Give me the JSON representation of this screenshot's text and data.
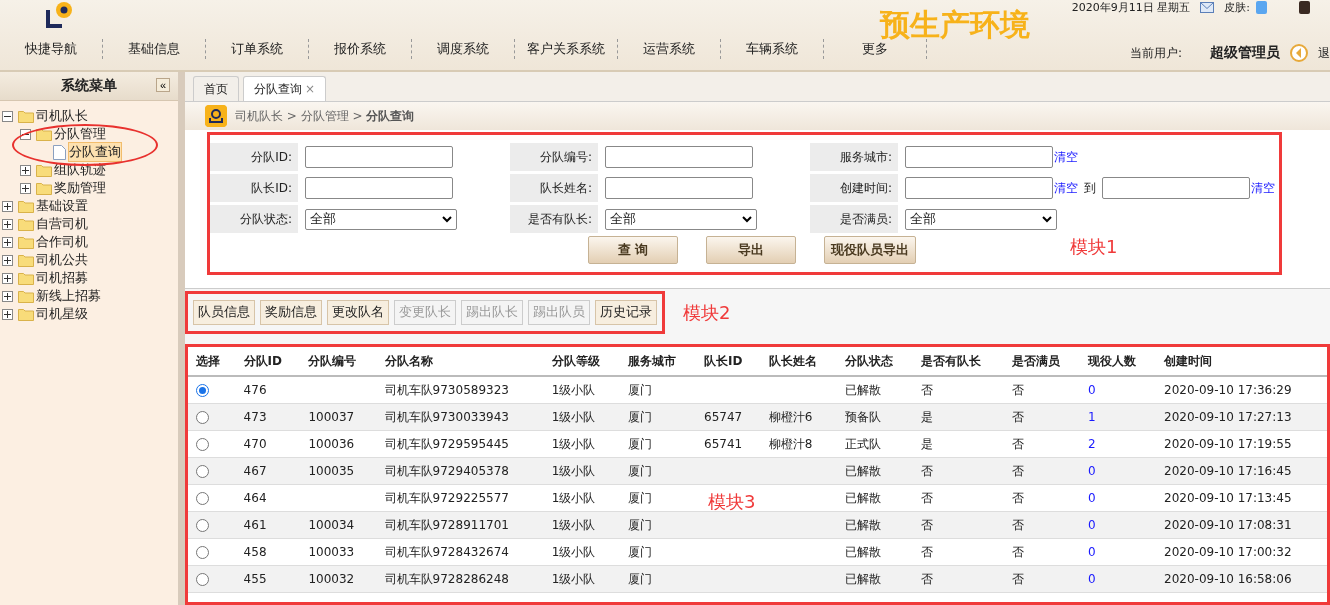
{
  "header": {
    "date": "2020年9月11日 星期五",
    "skin_label": "皮肤:",
    "env_banner": "预生产环境",
    "current_user_label": "当前用户:",
    "current_user": "超级管理员",
    "logout": "退"
  },
  "nav": [
    "快捷导航",
    "基础信息",
    "订单系统",
    "报价系统",
    "调度系统",
    "客户关系系统",
    "运营系统",
    "车辆系统",
    "更多"
  ],
  "sidebar": {
    "title": "系统菜单",
    "collapse": "«",
    "circled": true,
    "items": [
      {
        "label": "司机队长",
        "expanded": true,
        "selected": false,
        "children": [
          {
            "label": "分队管理",
            "expanded": true,
            "selected": false,
            "children": [
              {
                "label": "分队查询",
                "selected": true
              }
            ]
          },
          {
            "label": "组队轨迹",
            "expanded": false,
            "selected": false
          },
          {
            "label": "奖励管理",
            "expanded": false,
            "selected": false
          }
        ]
      },
      {
        "label": "基础设置",
        "expanded": false,
        "selected": false
      },
      {
        "label": "自营司机",
        "expanded": false,
        "selected": false
      },
      {
        "label": "合作司机",
        "expanded": false,
        "selected": false
      },
      {
        "label": "司机公共",
        "expanded": false,
        "selected": false
      },
      {
        "label": "司机招募",
        "expanded": false,
        "selected": false
      },
      {
        "label": "新线上招募",
        "expanded": false,
        "selected": false
      },
      {
        "label": "司机星级",
        "expanded": false,
        "selected": false
      }
    ]
  },
  "tabs": [
    {
      "label": "首页",
      "selected": false
    },
    {
      "label": "分队查询",
      "selected": true,
      "close": "×"
    }
  ],
  "breadcrumb": {
    "separator": ">",
    "items": [
      "司机队长",
      "分队管理",
      "分队查询"
    ]
  },
  "filters": {
    "annotation": "模块1",
    "rows": [
      [
        {
          "label": "分队ID:",
          "kind": "text"
        },
        {
          "label": "分队编号:",
          "kind": "text"
        },
        {
          "label": "服务城市:",
          "kind": "text",
          "clear": "清空"
        }
      ],
      [
        {
          "label": "队长ID:",
          "kind": "text"
        },
        {
          "label": "队长姓名:",
          "kind": "text"
        },
        {
          "label": "创建时间:",
          "kind": "range",
          "clear": "清空",
          "to": "到",
          "clear2": "清空"
        }
      ],
      [
        {
          "label": "分队状态:",
          "kind": "select",
          "value": "全部"
        },
        {
          "label": "是否有队长:",
          "kind": "select",
          "value": "全部"
        },
        {
          "label": "是否满员:",
          "kind": "select",
          "value": "全部"
        }
      ]
    ],
    "buttons": [
      "查 询",
      "导出",
      "现役队员导出"
    ]
  },
  "toolbar": {
    "annotation": "模块2",
    "buttons": [
      {
        "label": "队员信息",
        "disabled": false
      },
      {
        "label": "奖励信息",
        "disabled": false
      },
      {
        "label": "更改队名",
        "disabled": false
      },
      {
        "label": "变更队长",
        "disabled": true
      },
      {
        "label": "踢出队长",
        "disabled": true
      },
      {
        "label": "踢出队员",
        "disabled": true
      },
      {
        "label": "历史记录",
        "disabled": false
      }
    ]
  },
  "table": {
    "annotation": "模块3",
    "columns": [
      {
        "label": "选择",
        "kind": "radio"
      },
      {
        "label": "分队ID",
        "kind": "text"
      },
      {
        "label": "分队编号",
        "kind": "text"
      },
      {
        "label": "分队名称",
        "kind": "text"
      },
      {
        "label": "分队等级",
        "kind": "text"
      },
      {
        "label": "服务城市",
        "kind": "text"
      },
      {
        "label": "队长ID",
        "kind": "text"
      },
      {
        "label": "队长姓名",
        "kind": "text"
      },
      {
        "label": "分队状态",
        "kind": "text"
      },
      {
        "label": "是否有队长",
        "kind": "text"
      },
      {
        "label": "是否满员",
        "kind": "text"
      },
      {
        "label": "现役人数",
        "kind": "link"
      },
      {
        "label": "创建时间",
        "kind": "text"
      }
    ],
    "rows": [
      {
        "selected": true,
        "cells": [
          "",
          "476",
          "",
          "司机车队9730589323",
          "1级小队",
          "厦门",
          "",
          "",
          "已解散",
          "否",
          "否",
          "0",
          "2020-09-10 17:36:29"
        ]
      },
      {
        "selected": false,
        "cells": [
          "",
          "473",
          "100037",
          "司机车队9730033943",
          "1级小队",
          "厦门",
          "65747",
          "柳橙汁6",
          "预备队",
          "是",
          "否",
          "1",
          "2020-09-10 17:27:13"
        ]
      },
      {
        "selected": false,
        "cells": [
          "",
          "470",
          "100036",
          "司机车队9729595445",
          "1级小队",
          "厦门",
          "65741",
          "柳橙汁8",
          "正式队",
          "是",
          "否",
          "2",
          "2020-09-10 17:19:55"
        ]
      },
      {
        "selected": false,
        "cells": [
          "",
          "467",
          "100035",
          "司机车队9729405378",
          "1级小队",
          "厦门",
          "",
          "",
          "已解散",
          "否",
          "否",
          "0",
          "2020-09-10 17:16:45"
        ]
      },
      {
        "selected": false,
        "cells": [
          "",
          "464",
          "",
          "司机车队9729225577",
          "1级小队",
          "厦门",
          "",
          "",
          "已解散",
          "否",
          "否",
          "0",
          "2020-09-10 17:13:45"
        ]
      },
      {
        "selected": false,
        "cells": [
          "",
          "461",
          "100034",
          "司机车队9728911701",
          "1级小队",
          "厦门",
          "",
          "",
          "已解散",
          "否",
          "否",
          "0",
          "2020-09-10 17:08:31"
        ]
      },
      {
        "selected": false,
        "cells": [
          "",
          "458",
          "100033",
          "司机车队9728432674",
          "1级小队",
          "厦门",
          "",
          "",
          "已解散",
          "否",
          "否",
          "0",
          "2020-09-10 17:00:32"
        ]
      },
      {
        "selected": false,
        "cells": [
          "",
          "455",
          "100032",
          "司机车队9728286248",
          "1级小队",
          "厦门",
          "",
          "",
          "已解散",
          "否",
          "否",
          "0",
          "2020-09-10 16:58:06"
        ]
      }
    ]
  }
}
